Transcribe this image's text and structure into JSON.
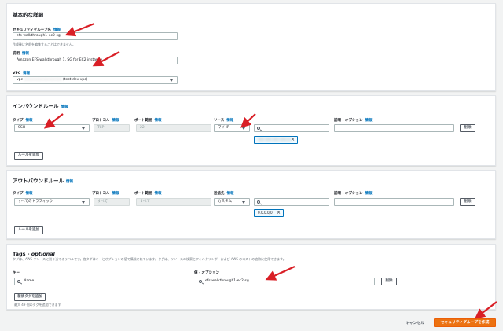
{
  "basic": {
    "title": "基本的な詳細",
    "name_label": "セキュリティグループ名",
    "info": "情報",
    "name_value": "efs-walkthrough1-ec2-sg",
    "name_hint": "作成後に名前を編集することはできません。",
    "desc_label": "説明",
    "desc_value": "Amazon EFS walkthrough 1, SG for EC2 instance",
    "vpc_label": "VPC",
    "vpc_prefix": "vpc-",
    "vpc_suffix": "(test-dev-vpc)"
  },
  "inbound": {
    "title": "インバウンドルール",
    "info": "情報",
    "col_type": "タイプ",
    "col_protocol": "プロトコル",
    "col_port": "ポート範囲",
    "col_source": "ソース",
    "col_desc": "説明 - オプション",
    "type_value": "SSH",
    "protocol_value": "TCP",
    "port_value": "22",
    "source_value": "マイ IP",
    "delete": "削除",
    "add_rule": "ルールを追加"
  },
  "outbound": {
    "title": "アウトバウンドルール",
    "info": "情報",
    "col_type": "タイプ",
    "col_protocol": "プロトコル",
    "col_port": "ポート範囲",
    "col_dest": "送信先",
    "col_desc": "説明 - オプション",
    "type_value": "すべてのトラフィック",
    "protocol_value": "すべて",
    "port_value": "すべて",
    "dest_value": "カスタム",
    "dest_token": "0.0.0.0/0",
    "delete": "削除",
    "add_rule": "ルールを追加"
  },
  "tags": {
    "title": "Tags - ",
    "title_optional": "optional",
    "description": "タグは、AWS リソースに割り当てるラベルです。各タグはキーとオプションの値で構成されています。タグは、リソースの検索とフィルタリング、および AWS のコストの追跡に使用できます。",
    "key_label": "キー",
    "value_label": "値 - オプション",
    "key_value": "Name",
    "value_value": "efs-walkthrough1-ec2-sg",
    "delete": "削除",
    "add_tag": "新規タグを追加",
    "limit_note": "最大 49 個のタグを追加できます"
  },
  "footer": {
    "cancel": "キャンセル",
    "create": "セキュリティグループを作成"
  },
  "colors": {
    "accent": "#ec7211",
    "link": "#0073bb",
    "arrow": "#d91f26"
  }
}
